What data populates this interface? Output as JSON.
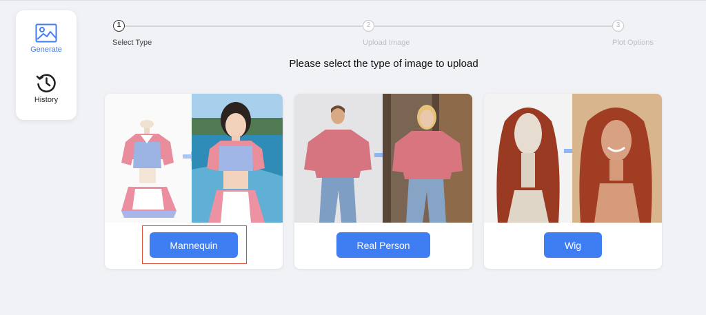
{
  "sidebar": {
    "items": [
      {
        "label": "Generate",
        "icon": "image-icon",
        "active": true
      },
      {
        "label": "History",
        "icon": "history-icon",
        "active": false
      }
    ]
  },
  "stepper": {
    "steps": [
      {
        "number": "1",
        "label": "Select Type",
        "active": true
      },
      {
        "number": "2",
        "label": "Upload Image",
        "active": false
      },
      {
        "number": "3",
        "label": "Plot Options",
        "active": false
      }
    ]
  },
  "heading": "Please select the type of image to upload",
  "cards": [
    {
      "label": "Mannequin",
      "selected": true
    },
    {
      "label": "Real Person",
      "selected": false
    },
    {
      "label": "Wig",
      "selected": false
    }
  ],
  "colors": {
    "accent": "#3f7ef2",
    "selection": "#e04f3a",
    "background": "#f1f2f6"
  }
}
